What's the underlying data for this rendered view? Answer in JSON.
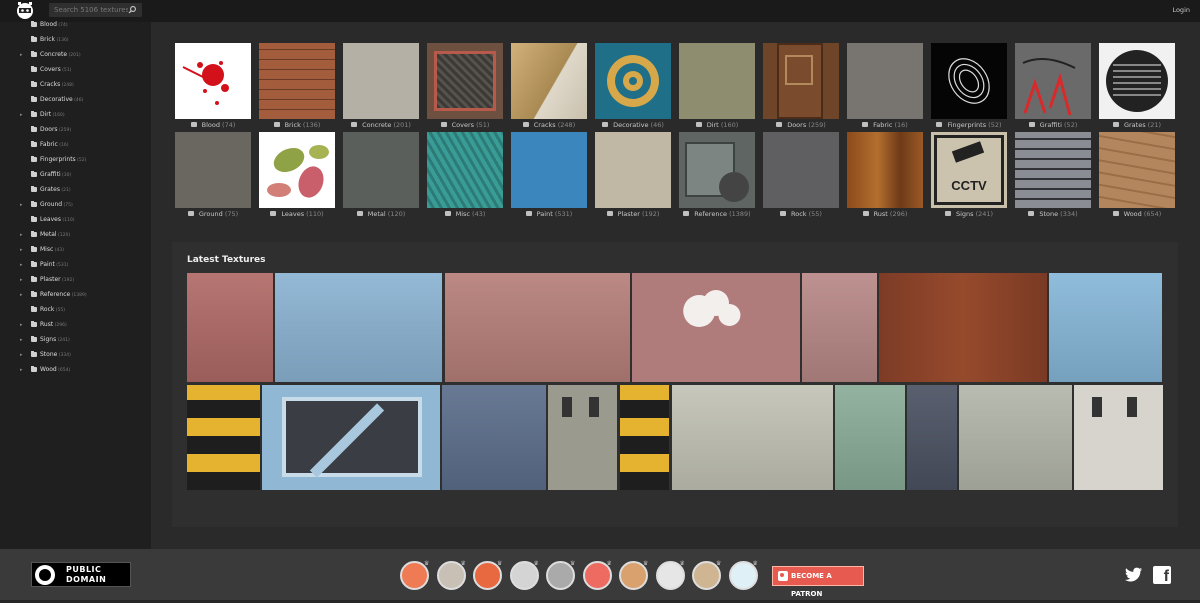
{
  "header": {
    "search_placeholder": "Search 5106 textures...",
    "login": "Login"
  },
  "sidebar": {
    "items": [
      {
        "label": "Blood",
        "count": "(74)",
        "expandable": false
      },
      {
        "label": "Brick",
        "count": "(136)",
        "expandable": false
      },
      {
        "label": "Concrete",
        "count": "(201)",
        "expandable": true
      },
      {
        "label": "Covers",
        "count": "(51)",
        "expandable": false
      },
      {
        "label": "Cracks",
        "count": "(248)",
        "expandable": false
      },
      {
        "label": "Decorative",
        "count": "(46)",
        "expandable": false
      },
      {
        "label": "Dirt",
        "count": "(160)",
        "expandable": true
      },
      {
        "label": "Doors",
        "count": "(259)",
        "expandable": false
      },
      {
        "label": "Fabric",
        "count": "(16)",
        "expandable": false
      },
      {
        "label": "Fingerprints",
        "count": "(52)",
        "expandable": false
      },
      {
        "label": "Graffiti",
        "count": "(30)",
        "expandable": false
      },
      {
        "label": "Grates",
        "count": "(21)",
        "expandable": false
      },
      {
        "label": "Ground",
        "count": "(75)",
        "expandable": true
      },
      {
        "label": "Leaves",
        "count": "(110)",
        "expandable": false
      },
      {
        "label": "Metal",
        "count": "(120)",
        "expandable": true
      },
      {
        "label": "Misc",
        "count": "(43)",
        "expandable": true
      },
      {
        "label": "Paint",
        "count": "(531)",
        "expandable": true
      },
      {
        "label": "Plaster",
        "count": "(192)",
        "expandable": true
      },
      {
        "label": "Reference",
        "count": "(1389)",
        "expandable": true
      },
      {
        "label": "Rock",
        "count": "(55)",
        "expandable": false
      },
      {
        "label": "Rust",
        "count": "(296)",
        "expandable": true
      },
      {
        "label": "Signs",
        "count": "(241)",
        "expandable": true
      },
      {
        "label": "Stone",
        "count": "(334)",
        "expandable": true
      },
      {
        "label": "Wood",
        "count": "(654)",
        "expandable": true
      }
    ]
  },
  "categories": [
    {
      "label": "Blood",
      "count": "(74)",
      "color": "#ffffff",
      "icon": "blood-splatter"
    },
    {
      "label": "Brick",
      "count": "(136)",
      "color": "#9a5a3a",
      "icon": "brick"
    },
    {
      "label": "Concrete",
      "count": "(201)",
      "color": "#b5b0a5",
      "icon": "concrete"
    },
    {
      "label": "Covers",
      "count": "(51)",
      "color": "#6d5040",
      "icon": "manhole-cover"
    },
    {
      "label": "Cracks",
      "count": "(248)",
      "color": "#c7a45c",
      "icon": "cracks"
    },
    {
      "label": "Decorative",
      "count": "(46)",
      "color": "#1f7d95",
      "icon": "ornament"
    },
    {
      "label": "Dirt",
      "count": "(160)",
      "color": "#8e8d70",
      "icon": "dirt"
    },
    {
      "label": "Doors",
      "count": "(259)",
      "color": "#6e4529",
      "icon": "door"
    },
    {
      "label": "Fabric",
      "count": "(16)",
      "color": "#787470",
      "icon": "fabric"
    },
    {
      "label": "Fingerprints",
      "count": "(52)",
      "color": "#050505",
      "icon": "fingerprint"
    },
    {
      "label": "Graffiti",
      "count": "(52)",
      "color": "#6c6c6c",
      "icon": "graffiti"
    },
    {
      "label": "Grates",
      "count": "(21)",
      "color": "#e8e8e8",
      "icon": "grate"
    },
    {
      "label": "Ground",
      "count": "(75)",
      "color": "#6a6660",
      "icon": "ground"
    },
    {
      "label": "Leaves",
      "count": "(110)",
      "color": "#ffffff",
      "icon": "leaves"
    },
    {
      "label": "Metal",
      "count": "(120)",
      "color": "#5b5f5c",
      "icon": "metal"
    },
    {
      "label": "Misc",
      "count": "(43)",
      "color": "#3d9590",
      "icon": "misc"
    },
    {
      "label": "Paint",
      "count": "(531)",
      "color": "#3b87bd",
      "icon": "paint"
    },
    {
      "label": "Plaster",
      "count": "(192)",
      "color": "#c0b8a5",
      "icon": "plaster"
    },
    {
      "label": "Reference",
      "count": "(1389)",
      "color": "#5f6563",
      "icon": "reference"
    },
    {
      "label": "Rock",
      "count": "(55)",
      "color": "#5f5e60",
      "icon": "rock"
    },
    {
      "label": "Rust",
      "count": "(296)",
      "color": "#8a4a1f",
      "icon": "rust"
    },
    {
      "label": "Signs",
      "count": "(241)",
      "color": "#c9c0ac",
      "icon": "cctv-sign",
      "text": "CCTV"
    },
    {
      "label": "Stone",
      "count": "(334)",
      "color": "#7a7d82",
      "icon": "stone"
    },
    {
      "label": "Wood",
      "count": "(654)",
      "color": "#a77a55",
      "icon": "wood"
    }
  ],
  "latest": {
    "title": "Latest Textures",
    "items": [
      {
        "color": "#b06a66",
        "icon": "red-wall"
      },
      {
        "color": "#8bb3d2",
        "icon": "blue-metal-wall"
      },
      {
        "color": "#b67f79",
        "icon": "pink-rusted-panel"
      },
      {
        "color": "#b07c7b",
        "icon": "pink-panel-with-cloud-graffiti"
      },
      {
        "color": "#b78886",
        "icon": "pink-peeling-paint"
      },
      {
        "color": "#8a3f2a",
        "icon": "rust-panel"
      },
      {
        "color": "#86b7d8",
        "icon": "blue-container"
      },
      {
        "color": "#222222",
        "icon": "yellow-black-stripes"
      },
      {
        "color": "#90b7d4",
        "icon": "blue-hatch"
      },
      {
        "color": "#5c6e8c",
        "icon": "blue-stickered-door"
      },
      {
        "color": "#9a9a8e",
        "icon": "grey-container-door"
      },
      {
        "color": "#222222",
        "icon": "yellow-black-stripes-2"
      },
      {
        "color": "#c2c3b5",
        "icon": "white-container-door"
      },
      {
        "color": "#8aac98",
        "icon": "green-container-door"
      },
      {
        "color": "#4b5262",
        "icon": "stickered-door"
      },
      {
        "color": "#b3b6aa",
        "icon": "grey-door"
      },
      {
        "color": "#d6d4cc",
        "icon": "white-van-doors"
      }
    ]
  },
  "footer": {
    "public_domain_line1": "PUBLIC",
    "public_domain_line2": "DOMAIN",
    "patron_button": "BECOME A PATRON",
    "patron_color": "#e65a4f"
  }
}
